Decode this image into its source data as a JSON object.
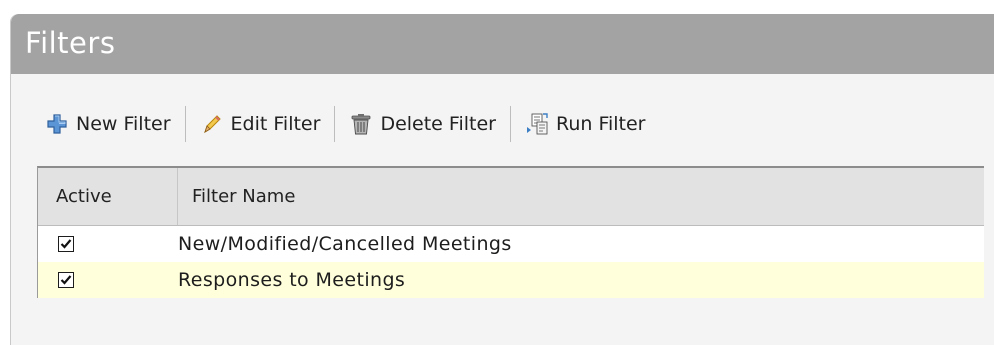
{
  "panel": {
    "title": "Filters"
  },
  "toolbar": {
    "new_filter": {
      "label": "New Filter",
      "icon": "plus-icon"
    },
    "edit_filter": {
      "label": "Edit Filter",
      "icon": "pencil-icon"
    },
    "delete_filter": {
      "label": "Delete Filter",
      "icon": "trash-icon"
    },
    "run_filter": {
      "label": "Run Filter",
      "icon": "run-filter-icon"
    }
  },
  "grid": {
    "columns": [
      "Active",
      "Filter Name"
    ],
    "rows": [
      {
        "active": true,
        "name": "New/Modified/Cancelled Meetings"
      },
      {
        "active": true,
        "name": "Responses to Meetings"
      }
    ]
  },
  "colors": {
    "header_bg": "#a3a3a3",
    "selected_row_bg": "#ffffdc",
    "plus_icon": "#4a86c8"
  }
}
